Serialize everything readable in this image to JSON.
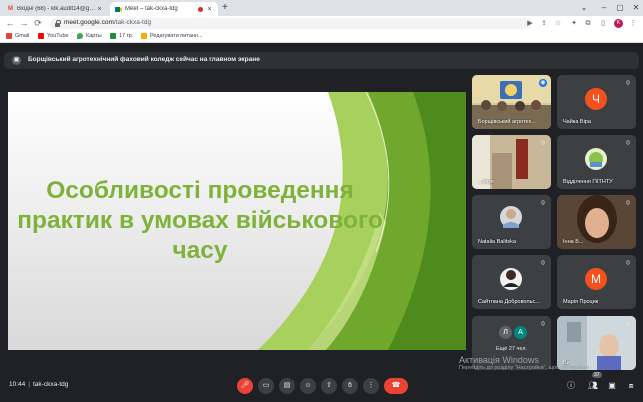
{
  "browser": {
    "tabs": [
      {
        "icon": "gmail-icon",
        "title": "Вхідні (68) - klk.audit14@gmail.c...",
        "active": false
      },
      {
        "icon": "meet-icon",
        "title": "Meet – tak-ckxa-tdg",
        "active": true,
        "recording": true
      }
    ],
    "url_host": "meet.google.com",
    "url_path": "/tak-ckxa-tdg",
    "profile_initial": "K",
    "bookmarks": [
      {
        "label": "Gmail",
        "icon": "gmail-icon",
        "color": "#ea4335"
      },
      {
        "label": "YouTube",
        "icon": "youtube-icon",
        "color": "#ff0000"
      },
      {
        "label": "Карты",
        "icon": "maps-icon",
        "color": "#34a853"
      },
      {
        "label": "17 гр.",
        "icon": "classroom-icon",
        "color": "#1e8e3e"
      },
      {
        "label": "Редагувати питанн...",
        "icon": "forms-icon",
        "color": "#f9ab00"
      }
    ]
  },
  "meet": {
    "presenting_text": "Борщівський агротехнічний фаховий коледж сейчас на главном экране",
    "slide_title": "Особливості проведення практик в умовах військового часу",
    "participants": [
      {
        "name": "Борщівський агротех...",
        "type": "photo",
        "mic": "active"
      },
      {
        "name": "Чайка Віра",
        "type": "avatar",
        "initial": "Ч",
        "color": "#f4511e",
        "mic": "muted"
      },
      {
        "name": "...ичук",
        "type": "photo",
        "mic": "muted"
      },
      {
        "name": "Відділення ГКТНТУ",
        "type": "photo",
        "mic": "muted"
      },
      {
        "name": "Natalia Balitska",
        "type": "photo",
        "mic": "muted"
      },
      {
        "name": "Інна Б...",
        "type": "photo",
        "mic": "muted"
      },
      {
        "name": "Сайтлана Добровольс...",
        "type": "photo",
        "mic": "muted"
      },
      {
        "name": "Марія Процик",
        "type": "avatar",
        "initial": "М",
        "color": "#f4511e",
        "mic": "muted"
      },
      {
        "name": "Ещё 27 чел.",
        "type": "more",
        "initials": [
          "Л",
          "А"
        ],
        "mic": "muted"
      },
      {
        "name": "Ви",
        "type": "photo",
        "mic": "muted"
      }
    ],
    "meeting_time": "10:44",
    "meeting_code": "tak-ckxa-tdg",
    "participant_count": "37",
    "watermark_title": "Активація Windows",
    "watermark_sub": "Перейдіть до розділу \"Настройки\", щоб активувати Windows."
  },
  "colors": {
    "slide_text": "#7fb23a",
    "slide_green_dark": "#4e8a1c",
    "slide_green_light": "#a8d05c",
    "hangup": "#ea4335"
  }
}
